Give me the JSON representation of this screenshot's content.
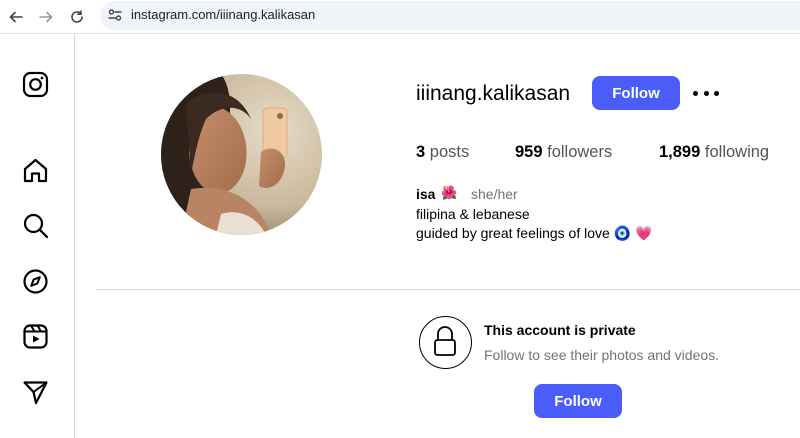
{
  "browser": {
    "url": "instagram.com/iiinang.kalikasan"
  },
  "sidebar": {
    "items": [
      {
        "icon": "instagram-logo-icon"
      },
      {
        "icon": "home-icon"
      },
      {
        "icon": "search-icon"
      },
      {
        "icon": "explore-compass-icon"
      },
      {
        "icon": "reels-icon"
      },
      {
        "icon": "messages-send-icon"
      }
    ]
  },
  "profile": {
    "username": "iiinang.kalikasan",
    "follow_label": "Follow",
    "stats": {
      "posts_count": "3",
      "posts_label": "posts",
      "followers_count": "959",
      "followers_label": "followers",
      "following_count": "1,899",
      "following_label": "following"
    },
    "bio": {
      "name": "isa",
      "name_emoji": "🌺",
      "pronouns": "she/her",
      "line1": "filipina & lebanese",
      "line2": "guided by great feelings of love",
      "line2_emojis": "🧿 💗"
    }
  },
  "private": {
    "title": "This account is private",
    "subtitle": "Follow to see their photos and videos.",
    "follow_label": "Follow"
  },
  "colors": {
    "accent": "#4a5df9",
    "divider": "#dbdbdb",
    "muted_text": "#737373"
  }
}
